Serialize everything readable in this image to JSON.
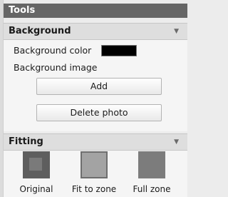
{
  "tools": {
    "title": "Tools"
  },
  "background": {
    "title": "Background",
    "color_label": "Background color",
    "color_value": "#000000",
    "image_label": "Background image",
    "add_label": "Add",
    "delete_label": "Delete photo"
  },
  "fitting": {
    "title": "Fitting",
    "options": [
      {
        "label": "Original",
        "icon": "fit-original-icon"
      },
      {
        "label": "Fit to zone",
        "icon": "fit-to-zone-icon"
      },
      {
        "label": "Full zone",
        "icon": "full-zone-icon"
      }
    ]
  },
  "colors": {
    "tools_header_bg": "#666666",
    "section_header_bg": "#dedede",
    "panel_bg": "#f5f5f5"
  }
}
